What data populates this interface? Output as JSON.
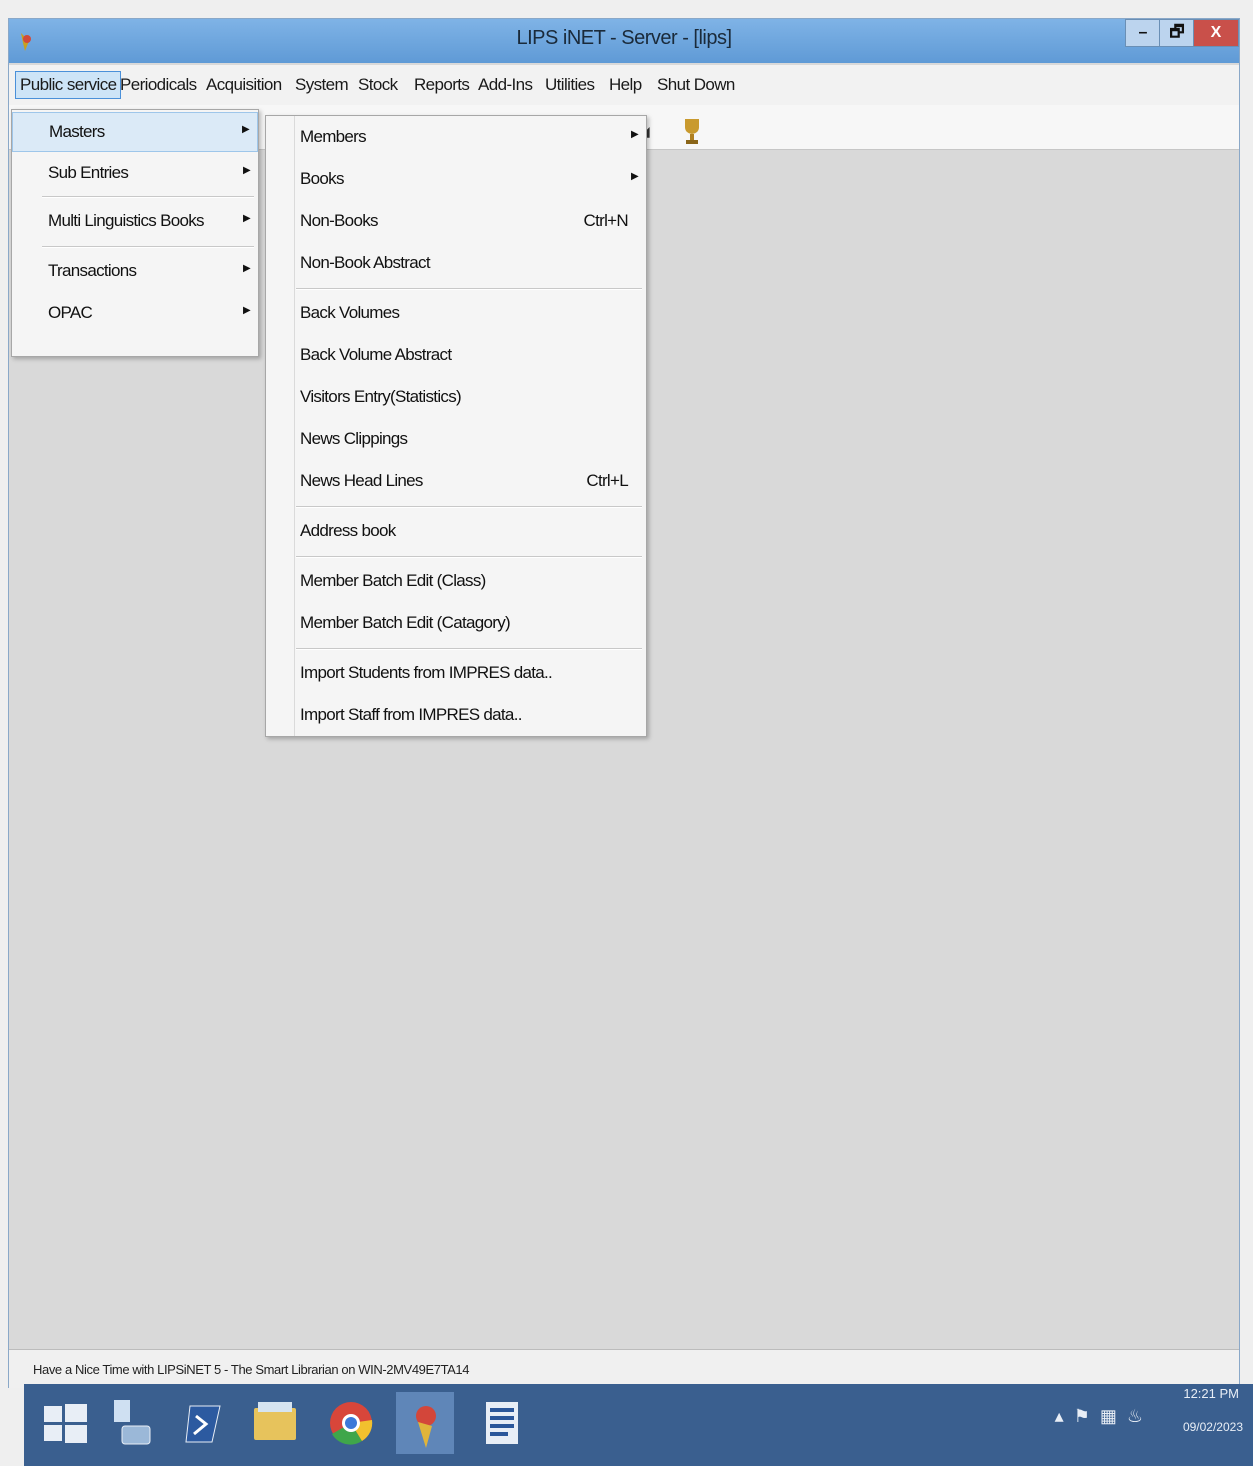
{
  "window": {
    "title": "LIPS iNET - Server - [lips]",
    "controls": {
      "minimize": "–",
      "maximize": "🗗",
      "close": "X"
    }
  },
  "menubar": {
    "items": [
      "Public service",
      "Periodicals",
      "Acquisition",
      "System",
      "Stock",
      "Reports",
      "Add-Ins",
      "Utilities",
      "Help",
      "Shut Down"
    ],
    "active": "Public service"
  },
  "public_service_menu": {
    "items": [
      {
        "label": "Masters",
        "has_submenu": true,
        "highlighted": true
      },
      {
        "label": "Sub Entries",
        "has_submenu": true
      },
      {
        "label": "Multi Linguistics Books",
        "has_submenu": true
      },
      {
        "label": "Transactions",
        "has_submenu": true
      },
      {
        "label": "OPAC",
        "has_submenu": true
      }
    ]
  },
  "masters_submenu": {
    "items": [
      {
        "label": "Members",
        "has_submenu": true,
        "shortcut": ""
      },
      {
        "label": "Books",
        "has_submenu": true,
        "shortcut": ""
      },
      {
        "label": "Non-Books",
        "has_submenu": false,
        "shortcut": "Ctrl+N"
      },
      {
        "label": "Non-Book Abstract",
        "has_submenu": false,
        "shortcut": ""
      },
      {
        "label": "Back Volumes",
        "has_submenu": false,
        "shortcut": ""
      },
      {
        "label": "Back Volume Abstract",
        "has_submenu": false,
        "shortcut": ""
      },
      {
        "label": "Visitors Entry(Statistics)",
        "has_submenu": false,
        "shortcut": ""
      },
      {
        "label": "News Clippings",
        "has_submenu": false,
        "shortcut": ""
      },
      {
        "label": "News Head Lines",
        "has_submenu": false,
        "shortcut": "Ctrl+L"
      },
      {
        "label": "Address book",
        "has_submenu": false,
        "shortcut": ""
      },
      {
        "label": "Member Batch Edit (Class)",
        "has_submenu": false,
        "shortcut": ""
      },
      {
        "label": "Member Batch Edit (Catagory)",
        "has_submenu": false,
        "shortcut": ""
      },
      {
        "label": "Import Students from IMPRES data..",
        "has_submenu": false,
        "shortcut": ""
      },
      {
        "label": "Import Staff from IMPRES data..",
        "has_submenu": false,
        "shortcut": ""
      }
    ]
  },
  "statusbar": {
    "text": "Have a Nice Time with LIPSiNET 5 - The Smart Librarian on WIN-2MV49E7TA14"
  },
  "taskbar": {
    "apps": [
      "windows-start-icon",
      "file-manager-icon",
      "powershell-icon",
      "file-explorer-icon",
      "chrome-icon",
      "lips-app-icon",
      "word-icon"
    ],
    "time": "12:21 PM",
    "date": "09/02/2023"
  },
  "colors": {
    "titlebar": "#6fa6de",
    "menu_highlight": "#dbeaf7",
    "taskbar": "#3a5f8f",
    "close_button": "#c9504a"
  }
}
